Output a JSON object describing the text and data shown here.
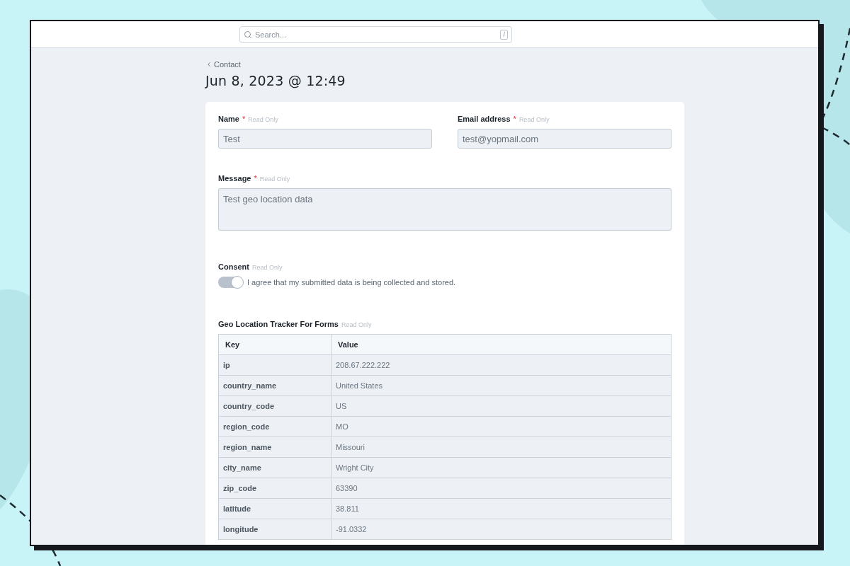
{
  "search": {
    "placeholder": "Search...",
    "shortcut": "/"
  },
  "breadcrumb": {
    "label": "Contact"
  },
  "title": "Jun 8, 2023 @ 12:49",
  "fields": [
    {
      "kind": "input",
      "label": "Name",
      "required_mark": "*",
      "note": "Read Only",
      "value": "Test"
    },
    {
      "kind": "input",
      "label": "Email address",
      "required_mark": "*",
      "note": "Read Only",
      "value": "test@yopmail.com"
    },
    {
      "kind": "textarea",
      "label": "Message",
      "required_mark": "*",
      "note": "Read Only",
      "value": "Test geo location data"
    },
    {
      "kind": "toggle",
      "label": "Consent",
      "note": "Read Only",
      "checked": true,
      "text": "I agree that my submitted data is being collected and stored."
    },
    {
      "kind": "table",
      "label": "Geo Location Tracker For Forms",
      "note": "Read Only",
      "columns": [
        "Key",
        "Value"
      ],
      "rows": [
        [
          "ip",
          "208.67.222.222"
        ],
        [
          "country_name",
          "United States"
        ],
        [
          "country_code",
          "US"
        ],
        [
          "region_code",
          "MO"
        ],
        [
          "region_name",
          "Missouri"
        ],
        [
          "city_name",
          "Wright City"
        ],
        [
          "zip_code",
          "63390"
        ],
        [
          "latitude",
          "38.811"
        ],
        [
          "longitude",
          "-91.0332"
        ]
      ]
    }
  ]
}
